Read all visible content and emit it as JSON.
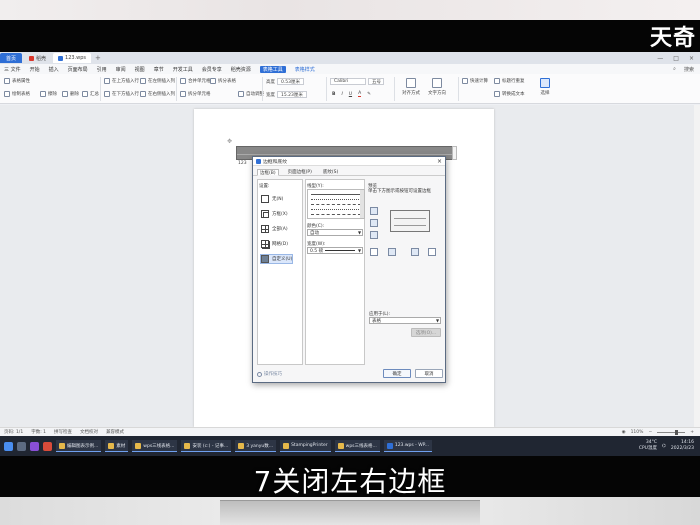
{
  "brand": "天奇",
  "subtitle": "7关闭左右边框",
  "tabbar": {
    "tabs": [
      {
        "label": "首页"
      },
      {
        "label": "稻壳"
      },
      {
        "label": "123.wps"
      }
    ],
    "add": "+"
  },
  "menubar": {
    "items": [
      "三 文件",
      "开始",
      "插入",
      "页面布局",
      "引用",
      "审阅",
      "视图",
      "章节",
      "开发工具",
      "会员专享",
      "稻壳资源",
      "表格工具",
      "表格样式"
    ],
    "right": [
      "搜索"
    ]
  },
  "ribbon": {
    "groups": [
      {
        "label": "表格属性"
      },
      {
        "label": "绘制表格"
      },
      {
        "label": "擦除"
      },
      {
        "label": "删除"
      },
      {
        "label": "汇总"
      },
      {
        "label": "在上方插入行"
      },
      {
        "label": "在下方插入行"
      },
      {
        "label": "在左侧插入列"
      },
      {
        "label": "在右侧插入列"
      },
      {
        "label": "合并单元格"
      },
      {
        "label": "拆分单元格"
      },
      {
        "label": "拆分表格"
      },
      {
        "label": "自动调整"
      },
      {
        "label": "高度"
      },
      {
        "label": "宽度"
      },
      {
        "label": "对齐方式"
      },
      {
        "label": "文字方向"
      },
      {
        "label": "快速计算"
      },
      {
        "label": "标题行重复"
      },
      {
        "label": "转换成文本"
      },
      {
        "label": "选择"
      }
    ],
    "height_value": "0.53厘米",
    "width_value": "15.23厘米",
    "font_name": "Calibri",
    "font_size": "五号"
  },
  "document": {
    "cell_label": "123"
  },
  "dialog": {
    "title": "边框和底纹",
    "close": "×",
    "tabs": [
      "边框(B)",
      "页面边框(P)",
      "底纹(S)"
    ],
    "settings_label": "设置:",
    "settings": [
      {
        "label": "无(N)"
      },
      {
        "label": "方框(X)"
      },
      {
        "label": "全部(A)"
      },
      {
        "label": "网格(D)"
      },
      {
        "label": "自定义(U)"
      }
    ],
    "line_style_label": "线型(Y):",
    "color_label": "颜色(C):",
    "color_value": "自动",
    "width_label": "宽度(W):",
    "width_value": "0.5 磅",
    "preview_label": "预览",
    "preview_hint": "单击下方图示或按钮可设置边框",
    "apply_label": "应用于(L):",
    "apply_value": "表格",
    "options_button": "选项(O)...",
    "tip": "操作技巧",
    "ok": "确定",
    "cancel": "取消"
  },
  "statusbar": {
    "page": "页码: 1/1",
    "words": "字数: 1",
    "spell": "拼写检查",
    "doc_check": "文档校对",
    "compat": "兼容模式",
    "zoom": "110%"
  },
  "taskbar": {
    "items": [
      {
        "label": "编辑图表示例..."
      },
      {
        "label": "素材"
      },
      {
        "label": "wps三线表格..."
      },
      {
        "label": "安装 (c:) - 记事..."
      },
      {
        "label": "3 yanyu数..."
      },
      {
        "label": "StampingPrinter"
      },
      {
        "label": "wps三线表格..."
      },
      {
        "label": "123.wps - WP..."
      }
    ],
    "weather": "34°C",
    "weather_sub": "CPU温度",
    "time": "14:16",
    "date": "2022/3/23"
  }
}
